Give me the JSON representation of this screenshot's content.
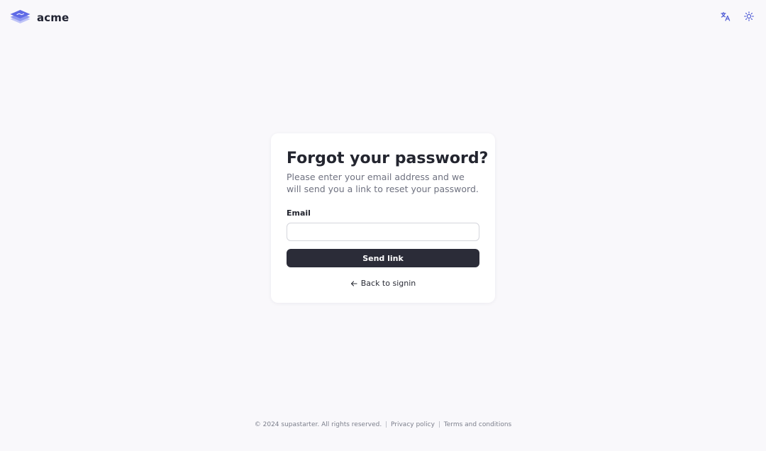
{
  "brand": {
    "name": "acme",
    "logo_icon": "layered-stack-logo",
    "logo_color": "#6470e8"
  },
  "header": {
    "language_icon": "translate-icon",
    "theme_icon": "sun-icon",
    "icon_color": "#4f5bd5"
  },
  "card": {
    "title": "Forgot your password?",
    "subtitle": "Please enter your email address and we will send you a link to reset your password.",
    "email_label": "Email",
    "email_value": "",
    "email_placeholder": "",
    "submit_label": "Send link",
    "back_label": "Back to signin",
    "back_icon": "arrow-left-icon",
    "button_color": "#2b2c38"
  },
  "footer": {
    "copyright": "© 2024 supastarter. All rights reserved.",
    "separator": "|",
    "privacy_label": "Privacy policy",
    "terms_label": "Terms and conditions"
  }
}
